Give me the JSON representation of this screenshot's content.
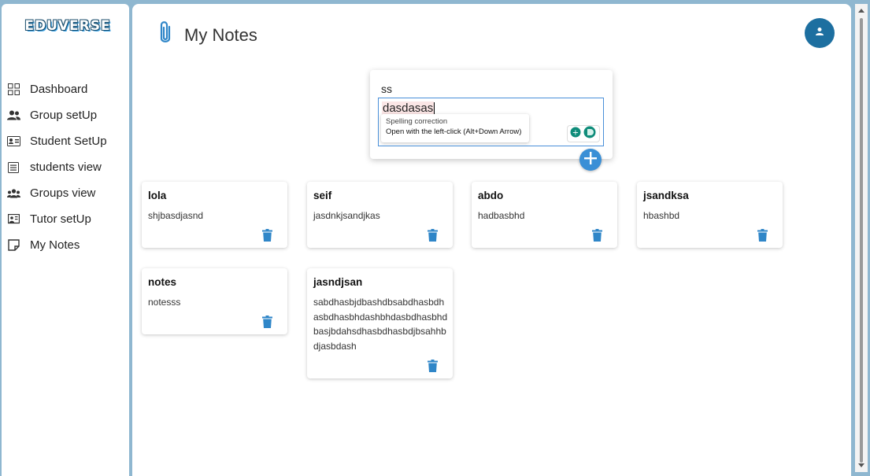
{
  "logo": {
    "text": "EDUVERSE"
  },
  "sidebar": {
    "items": [
      {
        "label": "Dashboard",
        "icon": "dashboard-icon"
      },
      {
        "label": "Group setUp",
        "icon": "group-icon"
      },
      {
        "label": "Student SetUp",
        "icon": "id-card-icon"
      },
      {
        "label": "students view",
        "icon": "list-icon"
      },
      {
        "label": "Groups view",
        "icon": "groups-icon"
      },
      {
        "label": "Tutor setUp",
        "icon": "tutor-icon"
      },
      {
        "label": "My Notes",
        "icon": "note-icon"
      }
    ]
  },
  "header": {
    "title": "My Notes",
    "icon": "paperclip-icon",
    "avatar_icon": "user-icon"
  },
  "composer": {
    "title_value": "ss",
    "text_value": "dasdasas",
    "tooltip_title": "Spelling correction",
    "tooltip_body": "Open with the left-click (Alt+Down Arrow)"
  },
  "notes": [
    {
      "title": "lola",
      "body": "shjbasdjasnd"
    },
    {
      "title": "seif",
      "body": "jasdnkjsandjkas"
    },
    {
      "title": "abdo",
      "body": "hadbasbhd"
    },
    {
      "title": "jsandksa",
      "body": "hbashbd"
    },
    {
      "title": "notes",
      "body": "notesss"
    },
    {
      "title": "jasndjsan",
      "body": "sabdhasbjdbashdbsabdhasbdhasbdhasbhdashbhdasbdhasbhdbasjbdahsdhasbdhasbdjbsahhbdjasbdash"
    }
  ],
  "colors": {
    "accent": "#3a8fd6",
    "avatar": "#1d6fa0",
    "frame": "#8fb7d0"
  }
}
